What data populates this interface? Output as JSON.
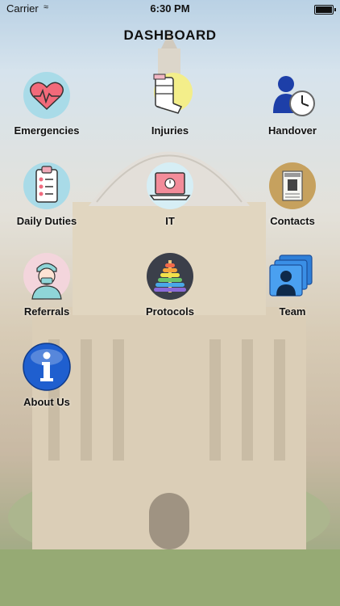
{
  "status_bar": {
    "carrier": "Carrier",
    "time": "6:30 PM"
  },
  "header": {
    "title": "DASHBOARD"
  },
  "tiles": [
    {
      "label": "Emergencies",
      "icon": "heart-icon"
    },
    {
      "label": "Injuries",
      "icon": "bandage-icon"
    },
    {
      "label": "Handover",
      "icon": "person-clock-icon"
    },
    {
      "label": "Daily Duties",
      "icon": "clipboard-icon"
    },
    {
      "label": "IT",
      "icon": "laptop-icon"
    },
    {
      "label": "Contacts",
      "icon": "contact-card-icon"
    },
    {
      "label": "Referrals",
      "icon": "nurse-icon"
    },
    {
      "label": "Protocols",
      "icon": "stacking-rings-icon"
    },
    {
      "label": "Team",
      "icon": "team-icon"
    },
    {
      "label": "About Us",
      "icon": "info-icon"
    }
  ],
  "colors": {
    "sky": "#9fc0db",
    "stone": "#c9b89a",
    "grass": "#6e8a3f",
    "accent_blue": "#1f5fcf"
  }
}
